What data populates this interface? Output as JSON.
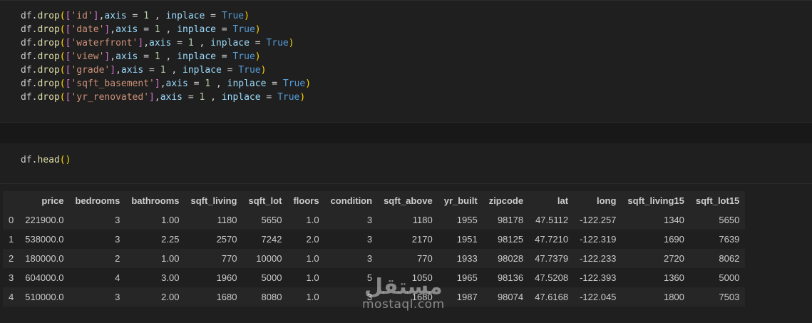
{
  "cells": {
    "drop_lines": [
      {
        "col": "'id'",
        "axis": "1",
        "inplace": "True"
      },
      {
        "col": "'date'",
        "axis": "1",
        "inplace": "True"
      },
      {
        "col": "'waterfront'",
        "axis": "1",
        "inplace": "True"
      },
      {
        "col": "'view'",
        "axis": "1",
        "inplace": "True"
      },
      {
        "col": "'grade'",
        "axis": "1",
        "inplace": "True"
      },
      {
        "col": "'sqft_basement'",
        "axis": "1",
        "inplace": "True"
      },
      {
        "col": "'yr_renovated'",
        "axis": "1",
        "inplace": "True"
      }
    ],
    "tokens": {
      "obj": "df",
      "method": "drop",
      "axis_kw": "axis",
      "inplace_kw": "inplace",
      "head_method": "head"
    }
  },
  "table": {
    "columns": [
      "",
      "price",
      "bedrooms",
      "bathrooms",
      "sqft_living",
      "sqft_lot",
      "floors",
      "condition",
      "sqft_above",
      "yr_built",
      "zipcode",
      "lat",
      "long",
      "sqft_living15",
      "sqft_lot15"
    ],
    "rows": [
      [
        "0",
        "221900.0",
        "3",
        "1.00",
        "1180",
        "5650",
        "1.0",
        "3",
        "1180",
        "1955",
        "98178",
        "47.5112",
        "-122.257",
        "1340",
        "5650"
      ],
      [
        "1",
        "538000.0",
        "3",
        "2.25",
        "2570",
        "7242",
        "2.0",
        "3",
        "2170",
        "1951",
        "98125",
        "47.7210",
        "-122.319",
        "1690",
        "7639"
      ],
      [
        "2",
        "180000.0",
        "2",
        "1.00",
        "770",
        "10000",
        "1.0",
        "3",
        "770",
        "1933",
        "98028",
        "47.7379",
        "-122.233",
        "2720",
        "8062"
      ],
      [
        "3",
        "604000.0",
        "4",
        "3.00",
        "1960",
        "5000",
        "1.0",
        "5",
        "1050",
        "1965",
        "98136",
        "47.5208",
        "-122.393",
        "1360",
        "5000"
      ],
      [
        "4",
        "510000.0",
        "3",
        "2.00",
        "1680",
        "8080",
        "1.0",
        "3",
        "1680",
        "1987",
        "98074",
        "47.6168",
        "-122.045",
        "1800",
        "7503"
      ]
    ]
  },
  "watermark": {
    "arabic": "مستقل",
    "latin": "mostaql.com"
  }
}
